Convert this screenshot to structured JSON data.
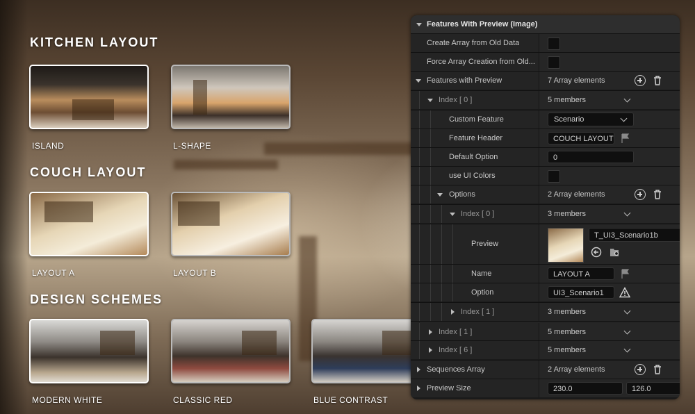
{
  "gallery": {
    "sections": [
      {
        "title": "KITCHEN LAYOUT",
        "items": [
          {
            "caption": "ISLAND"
          },
          {
            "caption": "L-SHAPE"
          }
        ]
      },
      {
        "title": "COUCH LAYOUT",
        "items": [
          {
            "caption": "LAYOUT A"
          },
          {
            "caption": "LAYOUT B"
          }
        ]
      },
      {
        "title": "DESIGN SCHEMES",
        "items": [
          {
            "caption": "MODERN WHITE"
          },
          {
            "caption": "CLASSIC RED"
          },
          {
            "caption": "BLUE CONTRAST"
          }
        ]
      }
    ]
  },
  "panel": {
    "header": "Features With Preview (Image)",
    "create_array_label": "Create Array from Old Data",
    "force_array_label": "Force Array Creation from Old...",
    "features_label": "Features with Preview",
    "features_count": "7 Array elements",
    "index0_label": "Index [ 0 ]",
    "index0_members": "5 members",
    "custom_feature_label": "Custom Feature",
    "custom_feature_value": "Scenario",
    "feature_header_label": "Feature Header",
    "feature_header_value": "COUCH LAYOUT",
    "default_option_label": "Default Option",
    "default_option_value": "0",
    "use_ui_colors_label": "use UI Colors",
    "options_label": "Options",
    "options_count": "2 Array elements",
    "opt_index0_label": "Index [ 0 ]",
    "opt_index0_members": "3 members",
    "preview_label": "Preview",
    "preview_asset": "T_UI3_Scenario1b",
    "name_label": "Name",
    "name_value": "LAYOUT A",
    "option_label": "Option",
    "option_value": "UI3_Scenario1",
    "opt_index1_label": "Index [ 1 ]",
    "opt_index1_members": "3 members",
    "index1_label": "Index [ 1 ]",
    "index1_members": "5 members",
    "index6_label": "Index [ 6 ]",
    "index6_members": "5 members",
    "sequences_label": "Sequences Array",
    "sequences_count": "2 Array elements",
    "preview_size_label": "Preview Size",
    "preview_size_x": "230.0",
    "preview_size_y": "126.0"
  }
}
